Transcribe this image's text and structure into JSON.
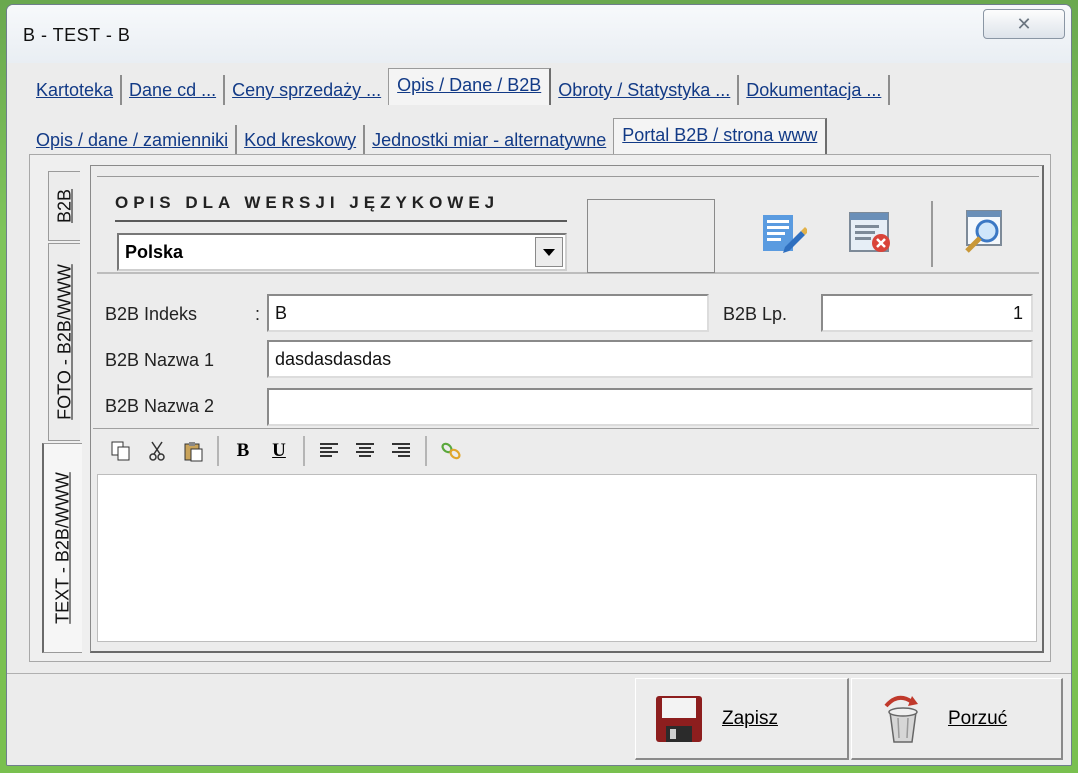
{
  "window": {
    "title": "B - TEST - B",
    "close_symbol": "✕"
  },
  "tabs_main": [
    {
      "label": "Kartoteka"
    },
    {
      "label": "Dane cd ..."
    },
    {
      "label": "Ceny sprzedaży ..."
    },
    {
      "label": "Opis / Dane / B2B",
      "active": true
    },
    {
      "label": "Obroty / Statystyka ..."
    },
    {
      "label": "Dokumentacja ..."
    }
  ],
  "tabs_sub": [
    {
      "label": "Opis / dane / zamienniki"
    },
    {
      "label": "Kod kreskowy"
    },
    {
      "label": "Jednostki miar - alternatywne"
    },
    {
      "label": "Portal B2B / strona www",
      "active": true
    }
  ],
  "vtabs": [
    {
      "label": "B2B"
    },
    {
      "label": "FOTO - B2B/WWW"
    },
    {
      "label": "TEXT - B2B/WWW",
      "active": true
    }
  ],
  "lang_section": {
    "title": "OPIS DLA WERSJI JĘZYKOWEJ",
    "selected": "Polska"
  },
  "fields": {
    "indeks_label": "B2B Indeks",
    "indeks_colon": ":",
    "indeks_value": "B",
    "lp_label": "B2B Lp.",
    "lp_value": "1",
    "nazwa1_label": "B2B Nazwa 1",
    "nazwa1_value": "dasdasdasdas",
    "nazwa2_label": "B2B Nazwa 2",
    "nazwa2_value": ""
  },
  "toolbar": {
    "bold": "B",
    "underline": "U"
  },
  "buttons": {
    "save": "Zapisz",
    "cancel": "Porzuć"
  },
  "icons": [
    "edit-document-icon",
    "delete-document-icon",
    "preview-search-icon",
    "copy-icon",
    "cut-icon",
    "paste-icon",
    "align-left-icon",
    "align-center-icon",
    "align-right-icon",
    "link-icon",
    "save-disk-icon",
    "trash-icon"
  ]
}
